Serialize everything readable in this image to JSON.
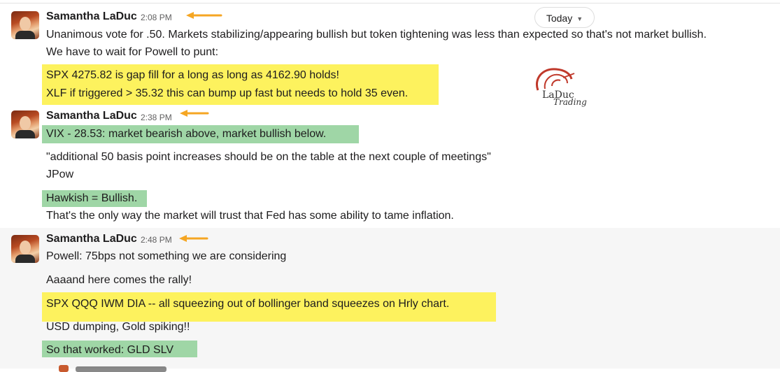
{
  "header": {
    "date_pill": "Today"
  },
  "messages": [
    {
      "author": "Samantha LaDuc",
      "time": "2:08 PM",
      "lines": [
        "Unanimous vote for .50. Markets stabilizing/appearing bullish but token tightening was less than expected so that's not market bullish.",
        "We have to wait for Powell to punt:",
        "SPX 4275.82 is gap fill for a long as long as 4162.90 holds!",
        "XLF if triggered > 35.32 this can bump up fast but needs to hold 35 even."
      ]
    },
    {
      "author": "Samantha LaDuc",
      "time": "2:38 PM",
      "lines": [
        "VIX - 28.53: market bearish above, market bullish below.",
        "\"additional 50 basis point increases should be on the table at the next couple of meetings\"",
        "JPow",
        "Hawkish = Bullish.",
        "That's the only way the market will trust that Fed has some ability to tame inflation."
      ]
    },
    {
      "author": "Samantha LaDuc",
      "time": "2:48 PM",
      "lines": [
        "Powell:  75bps not something we are considering",
        "Aaaand here comes the rally!",
        "SPX QQQ IWM DIA -- all squeezing out of bollinger band squeezes on Hrly chart.",
        "USD dumping, Gold spiking!!",
        "So that worked: GLD SLV"
      ]
    }
  ],
  "logo": {
    "line1": "LaDuc",
    "line2": "Trading"
  },
  "colors": {
    "highlight_yellow": "#fdf25e",
    "highlight_green": "#9fd6a6",
    "arrow": "#f5a623"
  }
}
